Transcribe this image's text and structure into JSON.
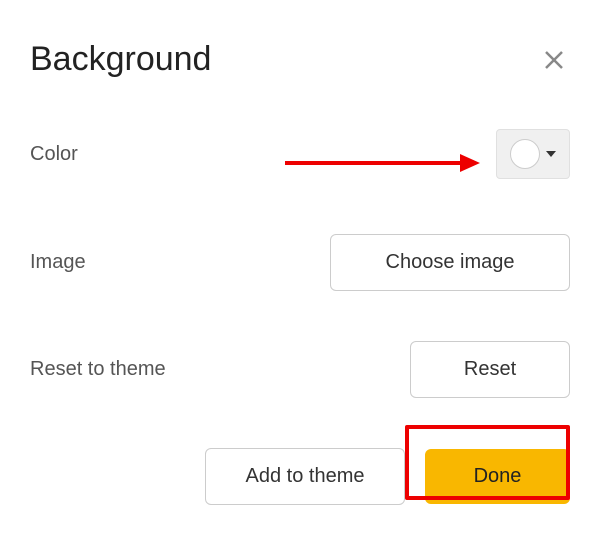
{
  "dialog": {
    "title": "Background"
  },
  "rows": {
    "color": {
      "label": "Color",
      "swatch_color": "#ffffff"
    },
    "image": {
      "label": "Image",
      "button_label": "Choose image"
    },
    "reset": {
      "label": "Reset to theme",
      "button_label": "Reset"
    }
  },
  "footer": {
    "add_to_theme_label": "Add to theme",
    "done_label": "Done"
  }
}
